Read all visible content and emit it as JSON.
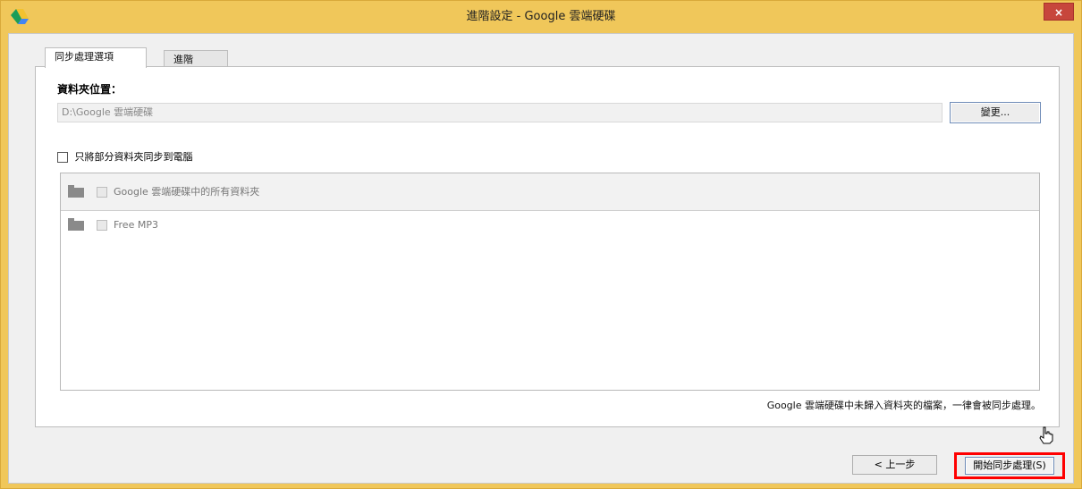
{
  "window": {
    "title": "進階設定 - Google 雲端硬碟",
    "close_label": "×"
  },
  "tabs": [
    {
      "label": "同步處理選項",
      "active": true
    },
    {
      "label": "進階",
      "active": false
    }
  ],
  "folder_location": {
    "label": "資料夾位置：",
    "path": "D:\\Google 雲端硬碟",
    "change_button": "變更..."
  },
  "partial_sync": {
    "checked": false,
    "label": "只將部分資料夾同步到電腦"
  },
  "folder_tree": {
    "items": [
      {
        "label": "Google 雲端硬碟中的所有資料夾",
        "checked": false
      },
      {
        "label": "Free MP3",
        "checked": false
      }
    ]
  },
  "footnote": "Google 雲端硬碟中未歸入資料夾的檔案，一律會被同步處理。",
  "buttons": {
    "back": "< 上一步",
    "start_sync": "開始同步處理(S)"
  },
  "colors": {
    "titlebar": "#f0c75a",
    "close_button": "#c7463c",
    "highlight_box": "#ff0000"
  }
}
